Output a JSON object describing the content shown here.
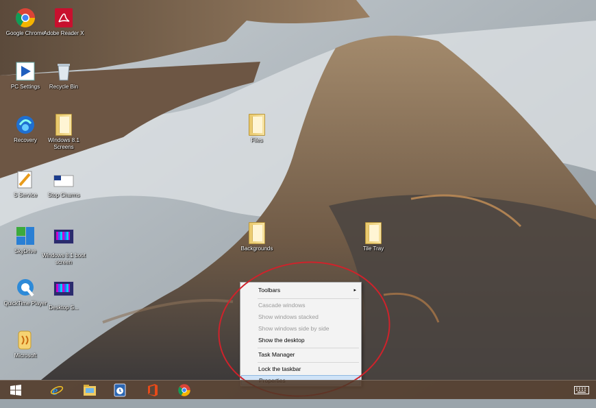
{
  "desktop": {
    "icons": [
      {
        "label": "Google Chrome",
        "icon": "chrome-icon"
      },
      {
        "label": "Adobe Reader X",
        "icon": "pdf-icon"
      },
      {
        "label": "PC Settings",
        "icon": "settings-shortcut-icon"
      },
      {
        "label": "Recycle Bin",
        "icon": "recycle-bin-icon"
      },
      {
        "label": "Recovery",
        "icon": "recovery-icon"
      },
      {
        "label": "Windows 8.1 Screens",
        "icon": "folder-icon"
      },
      {
        "label": "S Service",
        "icon": "service-icon"
      },
      {
        "label": "Stop Charms",
        "icon": "flag-icon"
      },
      {
        "label": "SkyDrive",
        "icon": "skydrive-icon"
      },
      {
        "label": "Windows 8.1 boot screen",
        "icon": "tile-icon"
      },
      {
        "label": "QuickTime Player",
        "icon": "quicktime-icon"
      },
      {
        "label": "Desktop S...",
        "icon": "tile-icon"
      },
      {
        "label": "Microsoft",
        "icon": "app-icon"
      },
      {
        "label": "Files",
        "icon": "folder-icon"
      },
      {
        "label": "Backgrounds",
        "icon": "folder-icon"
      },
      {
        "label": "Tile Tray",
        "icon": "folder-icon"
      }
    ]
  },
  "context_menu": {
    "items": [
      {
        "label": "Toolbars",
        "enabled": true,
        "submenu": true
      },
      {
        "label": "Cascade windows",
        "enabled": false
      },
      {
        "label": "Show windows stacked",
        "enabled": false
      },
      {
        "label": "Show windows side by side",
        "enabled": false
      },
      {
        "label": "Show the desktop",
        "enabled": true
      },
      {
        "label": "Task Manager",
        "enabled": true
      },
      {
        "label": "Lock the taskbar",
        "enabled": true
      },
      {
        "label": "Properties",
        "enabled": true,
        "selected": true
      }
    ],
    "submenu_arrow": "▸"
  },
  "taskbar": {
    "apps": [
      {
        "icon": "start-icon"
      },
      {
        "icon": "internet-explorer-icon"
      },
      {
        "icon": "file-explorer-icon"
      },
      {
        "icon": "task-scheduler-icon"
      },
      {
        "icon": "office-icon"
      },
      {
        "icon": "chrome-icon"
      }
    ],
    "tray_icon": "keyboard-icon"
  },
  "colors": {
    "annotation_circle": "#d0222b",
    "menu_highlight": "#cfe3f7"
  }
}
